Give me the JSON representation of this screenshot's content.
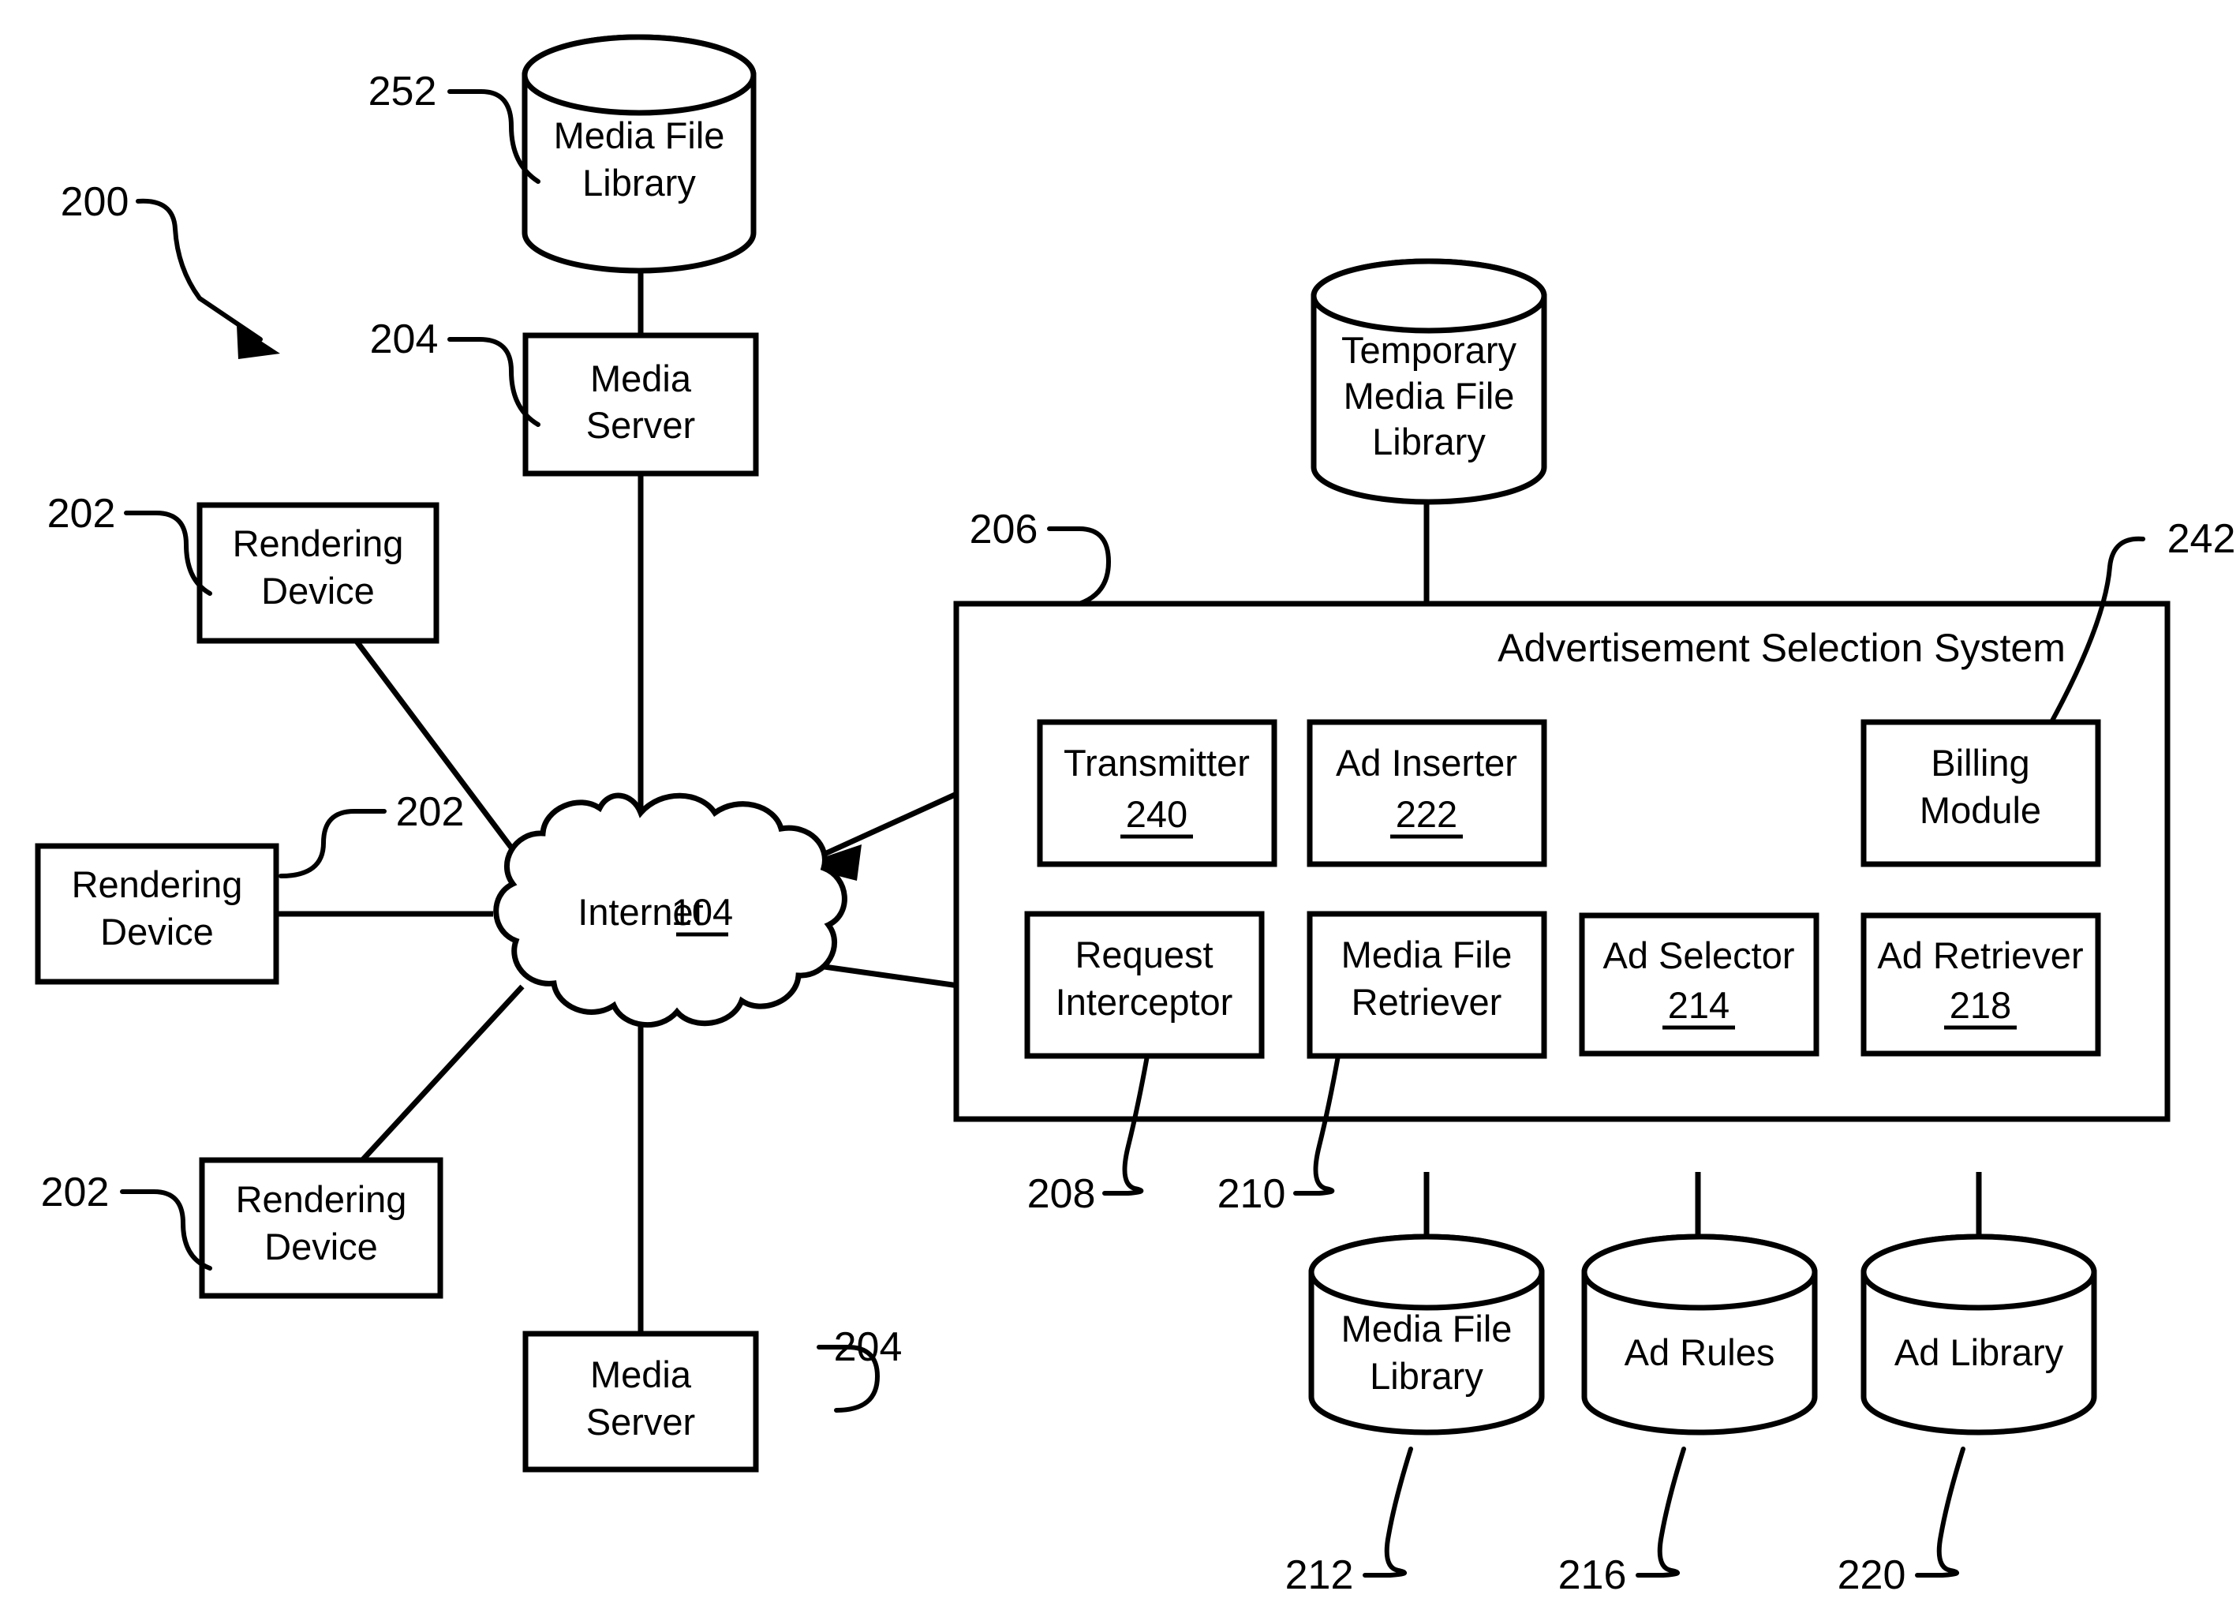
{
  "figure": {
    "overall_ref": "200"
  },
  "nodes": {
    "media_file_library_top": {
      "type": "cylinder",
      "lines": [
        "Media File",
        "Library"
      ],
      "ref": "252"
    },
    "media_server_top": {
      "type": "box",
      "lines": [
        "Media",
        "Server"
      ],
      "ref": "204"
    },
    "media_server_bottom": {
      "type": "box",
      "lines": [
        "Media",
        "Server"
      ],
      "ref": "204"
    },
    "rendering_device_1": {
      "type": "box",
      "lines": [
        "Rendering",
        "Device"
      ],
      "ref": "202"
    },
    "rendering_device_2": {
      "type": "box",
      "lines": [
        "Rendering",
        "Device"
      ],
      "ref": "202"
    },
    "rendering_device_3": {
      "type": "box",
      "lines": [
        "Rendering",
        "Device"
      ],
      "ref": "202"
    },
    "internet_cloud": {
      "type": "cloud",
      "label": "Internet",
      "ref": "104"
    },
    "temporary_media_file_library": {
      "type": "cylinder",
      "lines": [
        "Temporary",
        "Media File",
        "Library"
      ]
    },
    "advertisement_selection_system": {
      "type": "container",
      "title": "Advertisement Selection System",
      "ref": "206"
    },
    "transmitter": {
      "type": "box",
      "lines": [
        "Transmitter"
      ],
      "inline_ref": "240"
    },
    "ad_inserter": {
      "type": "box",
      "lines": [
        "Ad Inserter"
      ],
      "inline_ref": "222"
    },
    "billing_module": {
      "type": "box",
      "lines": [
        "Billing",
        "Module"
      ],
      "ref": "242"
    },
    "request_interceptor": {
      "type": "box",
      "lines": [
        "Request",
        "Interceptor"
      ],
      "ref": "208"
    },
    "media_file_retriever": {
      "type": "box",
      "lines": [
        "Media File",
        "Retriever"
      ],
      "ref": "210"
    },
    "ad_selector": {
      "type": "box",
      "lines": [
        "Ad Selector"
      ],
      "inline_ref": "214"
    },
    "ad_retriever": {
      "type": "box",
      "lines": [
        "Ad Retriever"
      ],
      "inline_ref": "218"
    },
    "media_file_library_bottom": {
      "type": "cylinder",
      "lines": [
        "Media File",
        "Library"
      ],
      "ref": "212"
    },
    "ad_rules": {
      "type": "cylinder",
      "lines": [
        "Ad Rules"
      ],
      "ref": "216"
    },
    "ad_library": {
      "type": "cylinder",
      "lines": [
        "Ad Library"
      ],
      "ref": "220"
    }
  },
  "colors": {
    "ink": "#000000",
    "paper": "#ffffff"
  }
}
